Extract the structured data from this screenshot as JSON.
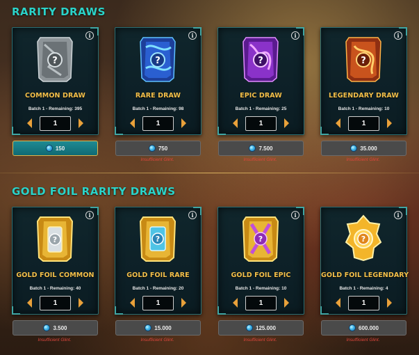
{
  "sections": {
    "rarity_title": "RARITY DRAWS",
    "gold_title": "GOLD FOIL RARITY DRAWS"
  },
  "colors": {
    "title_teal": "#2bd3c9",
    "card_name_gold": "#f4c04a",
    "insufficient_red": "#e0463d",
    "active_button_teal": "#1f8a93"
  },
  "info_glyph": "i",
  "insufficient_text": "Insufficient Glint.",
  "rarity_draws": [
    {
      "name": "COMMON DRAW",
      "batch": "Batch 1 - Remaining: 395",
      "quantity": "1",
      "price": "150",
      "affordable": true,
      "icon": "common-pack-icon"
    },
    {
      "name": "RARE DRAW",
      "batch": "Batch 1 - Remaining: 98",
      "quantity": "1",
      "price": "750",
      "affordable": false,
      "icon": "rare-pack-icon"
    },
    {
      "name": "EPIC DRAW",
      "batch": "Batch 1 - Remaining: 25",
      "quantity": "1",
      "price": "7.500",
      "affordable": false,
      "icon": "epic-pack-icon"
    },
    {
      "name": "LEGENDARY DRAW",
      "batch": "Batch 1 - Remaining: 10",
      "quantity": "1",
      "price": "35.000",
      "affordable": false,
      "icon": "legendary-pack-icon"
    }
  ],
  "gold_draws": [
    {
      "name": "GOLD FOIL COMMON",
      "batch": "Batch 1 - Remaining: 40",
      "quantity": "1",
      "price": "3.500",
      "affordable": false,
      "icon": "gold-common-pack-icon"
    },
    {
      "name": "GOLD FOIL RARE",
      "batch": "Batch 1 - Remaining: 20",
      "quantity": "1",
      "price": "15.000",
      "affordable": false,
      "icon": "gold-rare-pack-icon"
    },
    {
      "name": "GOLD FOIL EPIC",
      "batch": "Batch 1 - Remaining: 10",
      "quantity": "1",
      "price": "125.000",
      "affordable": false,
      "icon": "gold-epic-pack-icon"
    },
    {
      "name": "GOLD FOIL LEGENDARY",
      "batch": "Batch 1 - Remaining: 4",
      "quantity": "1",
      "price": "600.000",
      "affordable": false,
      "icon": "gold-legendary-pack-icon"
    }
  ]
}
